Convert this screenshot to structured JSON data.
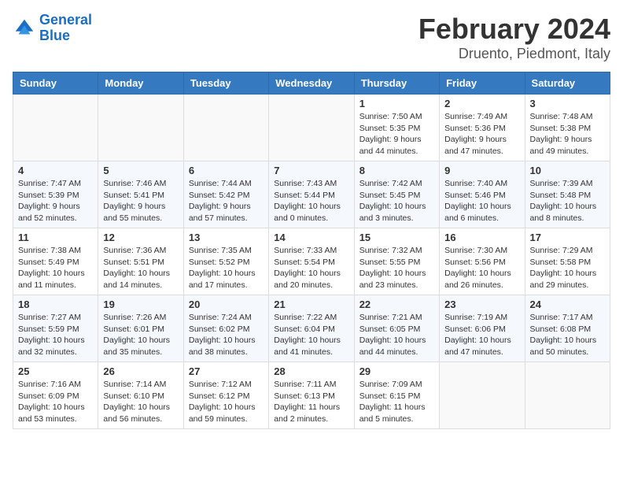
{
  "logo": {
    "name_part1": "General",
    "name_part2": "Blue"
  },
  "title": "February 2024",
  "subtitle": "Druento, Piedmont, Italy",
  "weekdays": [
    "Sunday",
    "Monday",
    "Tuesday",
    "Wednesday",
    "Thursday",
    "Friday",
    "Saturday"
  ],
  "weeks": [
    [
      {
        "day": "",
        "info": ""
      },
      {
        "day": "",
        "info": ""
      },
      {
        "day": "",
        "info": ""
      },
      {
        "day": "",
        "info": ""
      },
      {
        "day": "1",
        "info": "Sunrise: 7:50 AM\nSunset: 5:35 PM\nDaylight: 9 hours\nand 44 minutes."
      },
      {
        "day": "2",
        "info": "Sunrise: 7:49 AM\nSunset: 5:36 PM\nDaylight: 9 hours\nand 47 minutes."
      },
      {
        "day": "3",
        "info": "Sunrise: 7:48 AM\nSunset: 5:38 PM\nDaylight: 9 hours\nand 49 minutes."
      }
    ],
    [
      {
        "day": "4",
        "info": "Sunrise: 7:47 AM\nSunset: 5:39 PM\nDaylight: 9 hours\nand 52 minutes."
      },
      {
        "day": "5",
        "info": "Sunrise: 7:46 AM\nSunset: 5:41 PM\nDaylight: 9 hours\nand 55 minutes."
      },
      {
        "day": "6",
        "info": "Sunrise: 7:44 AM\nSunset: 5:42 PM\nDaylight: 9 hours\nand 57 minutes."
      },
      {
        "day": "7",
        "info": "Sunrise: 7:43 AM\nSunset: 5:44 PM\nDaylight: 10 hours\nand 0 minutes."
      },
      {
        "day": "8",
        "info": "Sunrise: 7:42 AM\nSunset: 5:45 PM\nDaylight: 10 hours\nand 3 minutes."
      },
      {
        "day": "9",
        "info": "Sunrise: 7:40 AM\nSunset: 5:46 PM\nDaylight: 10 hours\nand 6 minutes."
      },
      {
        "day": "10",
        "info": "Sunrise: 7:39 AM\nSunset: 5:48 PM\nDaylight: 10 hours\nand 8 minutes."
      }
    ],
    [
      {
        "day": "11",
        "info": "Sunrise: 7:38 AM\nSunset: 5:49 PM\nDaylight: 10 hours\nand 11 minutes."
      },
      {
        "day": "12",
        "info": "Sunrise: 7:36 AM\nSunset: 5:51 PM\nDaylight: 10 hours\nand 14 minutes."
      },
      {
        "day": "13",
        "info": "Sunrise: 7:35 AM\nSunset: 5:52 PM\nDaylight: 10 hours\nand 17 minutes."
      },
      {
        "day": "14",
        "info": "Sunrise: 7:33 AM\nSunset: 5:54 PM\nDaylight: 10 hours\nand 20 minutes."
      },
      {
        "day": "15",
        "info": "Sunrise: 7:32 AM\nSunset: 5:55 PM\nDaylight: 10 hours\nand 23 minutes."
      },
      {
        "day": "16",
        "info": "Sunrise: 7:30 AM\nSunset: 5:56 PM\nDaylight: 10 hours\nand 26 minutes."
      },
      {
        "day": "17",
        "info": "Sunrise: 7:29 AM\nSunset: 5:58 PM\nDaylight: 10 hours\nand 29 minutes."
      }
    ],
    [
      {
        "day": "18",
        "info": "Sunrise: 7:27 AM\nSunset: 5:59 PM\nDaylight: 10 hours\nand 32 minutes."
      },
      {
        "day": "19",
        "info": "Sunrise: 7:26 AM\nSunset: 6:01 PM\nDaylight: 10 hours\nand 35 minutes."
      },
      {
        "day": "20",
        "info": "Sunrise: 7:24 AM\nSunset: 6:02 PM\nDaylight: 10 hours\nand 38 minutes."
      },
      {
        "day": "21",
        "info": "Sunrise: 7:22 AM\nSunset: 6:04 PM\nDaylight: 10 hours\nand 41 minutes."
      },
      {
        "day": "22",
        "info": "Sunrise: 7:21 AM\nSunset: 6:05 PM\nDaylight: 10 hours\nand 44 minutes."
      },
      {
        "day": "23",
        "info": "Sunrise: 7:19 AM\nSunset: 6:06 PM\nDaylight: 10 hours\nand 47 minutes."
      },
      {
        "day": "24",
        "info": "Sunrise: 7:17 AM\nSunset: 6:08 PM\nDaylight: 10 hours\nand 50 minutes."
      }
    ],
    [
      {
        "day": "25",
        "info": "Sunrise: 7:16 AM\nSunset: 6:09 PM\nDaylight: 10 hours\nand 53 minutes."
      },
      {
        "day": "26",
        "info": "Sunrise: 7:14 AM\nSunset: 6:10 PM\nDaylight: 10 hours\nand 56 minutes."
      },
      {
        "day": "27",
        "info": "Sunrise: 7:12 AM\nSunset: 6:12 PM\nDaylight: 10 hours\nand 59 minutes."
      },
      {
        "day": "28",
        "info": "Sunrise: 7:11 AM\nSunset: 6:13 PM\nDaylight: 11 hours\nand 2 minutes."
      },
      {
        "day": "29",
        "info": "Sunrise: 7:09 AM\nSunset: 6:15 PM\nDaylight: 11 hours\nand 5 minutes."
      },
      {
        "day": "",
        "info": ""
      },
      {
        "day": "",
        "info": ""
      }
    ]
  ]
}
